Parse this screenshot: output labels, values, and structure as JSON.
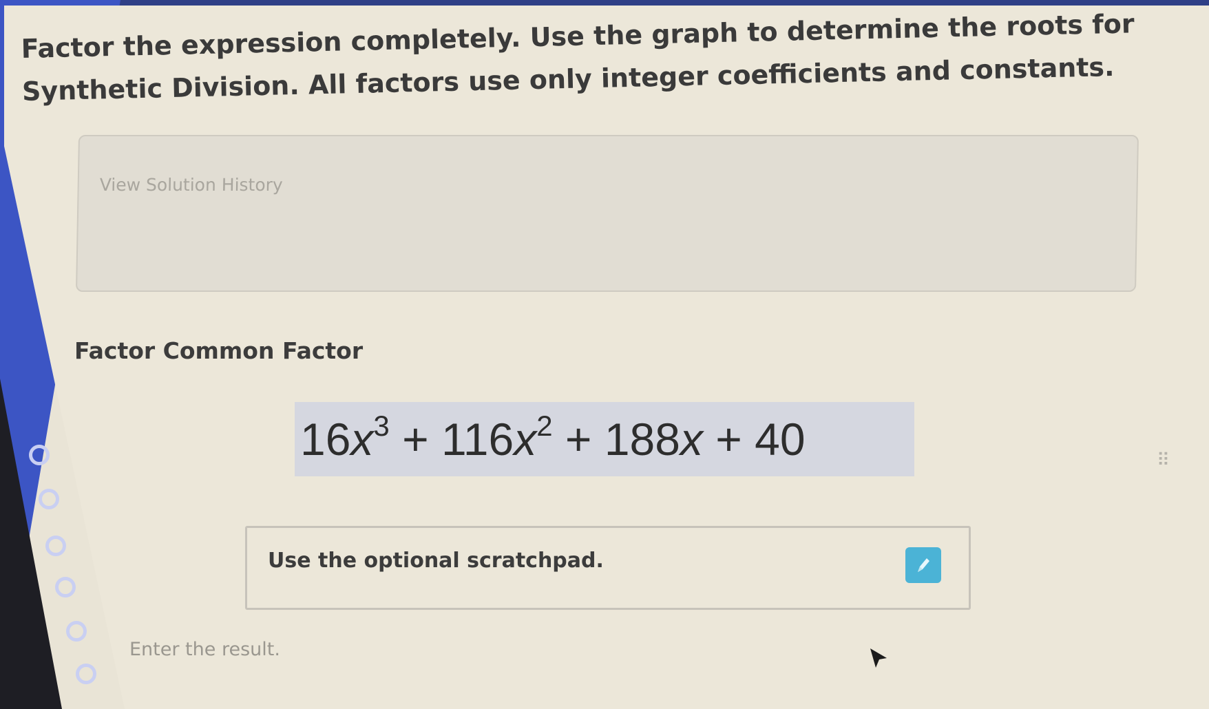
{
  "instruction": {
    "text": "Factor the expression completely. Use the graph to determine the roots for Synthetic Division. All factors use only integer coefficients and constants."
  },
  "history": {
    "link_label": "View Solution History"
  },
  "step": {
    "title": "Factor Common Factor"
  },
  "expression": {
    "c1": "16",
    "v1": "x",
    "e1": "3",
    "op1": " + ",
    "c2": "116",
    "v2": "x",
    "e2": "2",
    "op2": " + ",
    "c3": "188",
    "v3": "x",
    "op3": " + ",
    "c4": "40"
  },
  "drag_handle": {
    "glyph": "⠿"
  },
  "scratchpad": {
    "label": "Use the optional scratchpad.",
    "icon": "pencil-icon"
  },
  "result": {
    "placeholder": "Enter the result."
  },
  "colors": {
    "left_rail": "#3c55c4",
    "pencil_button": "#4bb3d6",
    "expression_bg": "#d5d7e0"
  }
}
